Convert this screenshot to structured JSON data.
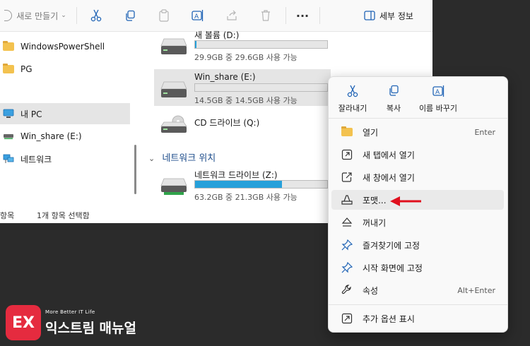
{
  "toolbar": {
    "new_label": "새로 만들기",
    "details_label": "세부 정보"
  },
  "sidebar": {
    "items": [
      {
        "label": "WindowsPowerShell"
      },
      {
        "label": "PG"
      },
      {
        "label": "내 PC"
      },
      {
        "label": "Win_share (E:)"
      },
      {
        "label": "네트워크"
      }
    ]
  },
  "status": {
    "count": "항목",
    "selected": "1개 항목 선택함"
  },
  "drives": [
    {
      "name": "새 볼륨 (D:)",
      "info": "29.9GB 중 29.6GB 사용 가능",
      "used_fraction": 0.01
    },
    {
      "name": "Win_share (E:)",
      "info": "14.5GB 중 14.5GB 사용 가능",
      "used_fraction": 0.0
    },
    {
      "name": "CD 드라이브 (Q:)",
      "info": ""
    },
    {
      "name": "네트워크 드라이브 (Z:)",
      "info": "63.2GB 중 21.3GB 사용 가능",
      "used_fraction": 0.66
    }
  ],
  "section": {
    "network_location": "네트워크 위치"
  },
  "context_menu": {
    "top_actions": [
      {
        "label": "잘라내기",
        "icon": "scissors-icon"
      },
      {
        "label": "복사",
        "icon": "copy-icon"
      },
      {
        "label": "이름 바꾸기",
        "icon": "rename-icon"
      }
    ],
    "items": [
      {
        "label": "열기",
        "shortcut": "Enter",
        "icon": "folder-icon"
      },
      {
        "label": "새 탭에서 열기",
        "shortcut": "",
        "icon": "new-tab-icon"
      },
      {
        "label": "새 창에서 열기",
        "shortcut": "",
        "icon": "new-window-icon"
      },
      {
        "label": "포맷...",
        "shortcut": "",
        "icon": "format-icon"
      },
      {
        "label": "꺼내기",
        "shortcut": "",
        "icon": "eject-icon"
      },
      {
        "label": "즐겨찾기에 고정",
        "shortcut": "",
        "icon": "pin-icon"
      },
      {
        "label": "시작 화면에 고정",
        "shortcut": "",
        "icon": "pin-start-icon"
      },
      {
        "label": "속성",
        "shortcut": "Alt+Enter",
        "icon": "wrench-icon"
      },
      {
        "label": "추가 옵션 표시",
        "shortcut": "",
        "icon": "more-options-icon"
      }
    ]
  },
  "logo": {
    "badge": "EX",
    "tagline": "More Better IT Life",
    "title": "익스트림 매뉴얼"
  },
  "colors": {
    "accent": "#26a0da",
    "menu_bg": "#f9f9f9",
    "logo_red": "#e52b3f",
    "arrow_red": "#e0101e",
    "network_free": "#2fa34a"
  }
}
